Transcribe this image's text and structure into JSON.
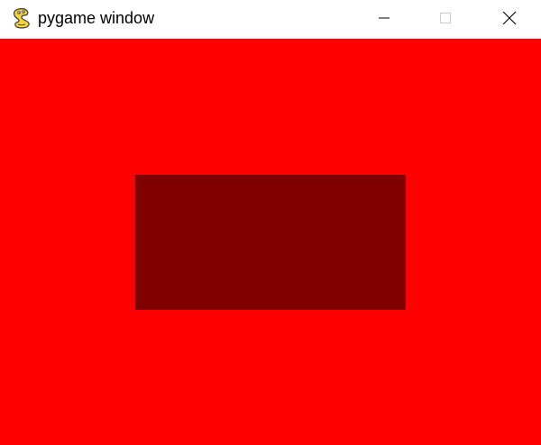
{
  "window": {
    "title": "pygame window",
    "app_icon": "pygame-snake-icon",
    "controls": {
      "minimize_icon": "minimize-icon",
      "maximize_icon": "maximize-icon",
      "close_icon": "close-icon"
    }
  },
  "canvas": {
    "background_color": "#FF0000",
    "rectangle_color": "#800000"
  }
}
